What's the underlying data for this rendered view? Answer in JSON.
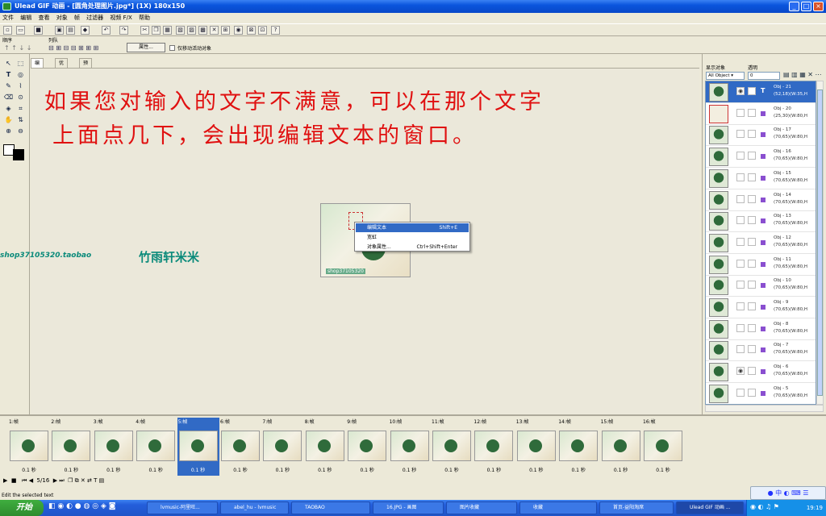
{
  "window": {
    "title": "Ulead GIF 动画 - [圆角处理图片.jpg*] (1X) 180x150",
    "controls": [
      "_",
      "□",
      "×"
    ]
  },
  "menu": [
    "文件",
    "编辑",
    "查看",
    "对象",
    "帧",
    "过滤器",
    "视频 F/X",
    "帮助"
  ],
  "toolbar2": {
    "order_label": "顺序",
    "queue_label": "列队",
    "props_button": "属性...",
    "move_checkbox_label": "仅移动活动对象"
  },
  "tabs": [
    "编辑",
    "优化",
    "预览"
  ],
  "overlay": {
    "line1": "如果您对输入的文字不满意，可以在那个文字",
    "line2": "上面点几下，会出现编辑文本的窗口。",
    "shop": "shop37105320.taobao",
    "shop_cn": "竹雨轩米米",
    "canvas_caption": "shop37105320"
  },
  "context_menu": [
    {
      "label": "编辑文本",
      "shortcut": "Shift+E"
    },
    {
      "label": "宽虹",
      "shortcut": ""
    },
    {
      "label": "对象属性...",
      "shortcut": "Ctrl+Shift+Enter"
    }
  ],
  "right_panel": {
    "display_label": "显示对象",
    "display_value": "All Object",
    "opacity_label": "透明",
    "opacity_value": "0",
    "objects": [
      {
        "name": "Obj - 21",
        "coords": "(52,18)(W:35,H",
        "type": "T"
      },
      {
        "name": "Obj - 20",
        "coords": "(25,30)(W:80,H",
        "type": ""
      },
      {
        "name": "Obj - 17",
        "coords": "(70,65)(W:80,H",
        "type": ""
      },
      {
        "name": "Obj - 16",
        "coords": "(70,65)(W:80,H",
        "type": ""
      },
      {
        "name": "Obj - 15",
        "coords": "(70,65)(W:80,H",
        "type": ""
      },
      {
        "name": "Obj - 14",
        "coords": "(70,65)(W:80,H",
        "type": ""
      },
      {
        "name": "Obj - 13",
        "coords": "(70,65)(W:80,H",
        "type": ""
      },
      {
        "name": "Obj - 12",
        "coords": "(70,65)(W:80,H",
        "type": ""
      },
      {
        "name": "Obj - 11",
        "coords": "(70,65)(W:80,H",
        "type": ""
      },
      {
        "name": "Obj - 10",
        "coords": "(70,65)(W:80,H",
        "type": ""
      },
      {
        "name": "Obj - 9",
        "coords": "(70,65)(W:80,H",
        "type": ""
      },
      {
        "name": "Obj - 8",
        "coords": "(70,65)(W:80,H",
        "type": ""
      },
      {
        "name": "Obj - 7",
        "coords": "(70,65)(W:80,H",
        "type": ""
      },
      {
        "name": "Obj - 6",
        "coords": "(70,65)(W:80,H",
        "type": ""
      },
      {
        "name": "Obj - 5",
        "coords": "(70,65)(W:80,H",
        "type": ""
      }
    ]
  },
  "frames": {
    "labels": [
      "1:帧",
      "2:帧",
      "3:帧",
      "4:帧",
      "5:帧",
      "6:帧",
      "7:帧",
      "8:帧",
      "9:帧",
      "10:帧",
      "11:帧",
      "12:帧",
      "13:帧",
      "14:帧",
      "15:帧",
      "16:帧"
    ],
    "delay": "0.1 秒",
    "selected_index": 4,
    "counter": "5/16"
  },
  "status": "Edit the selected text",
  "taskbar": {
    "start": "开始",
    "tasks": [
      "lvmusic-阿里旺...",
      "abel_hu - lvmusic",
      "TAOBAO",
      "16.JPG - 画图",
      "图片收藏",
      "收藏",
      "首页-益阳淘席",
      "Ulead GIF 动画 ..."
    ],
    "clock": "19:19"
  }
}
